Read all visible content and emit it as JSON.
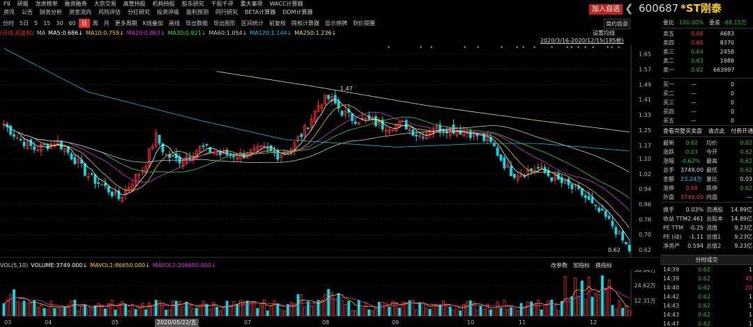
{
  "menu_row1": [
    "F9",
    "研报",
    "龙虎榜单",
    "融资融券",
    "大宗交易",
    "高管持股",
    "机构持股",
    "股东研究",
    "千股千评",
    "重大事项",
    "WACC计算器"
  ],
  "menu_row2": [
    "资讯",
    "公告",
    "财务分析",
    "资金流向",
    "风险评估",
    "分红研究",
    "投资评级",
    "盈利预测",
    "同行研究",
    "BETA计算器",
    "DDM计算器"
  ],
  "toolbar": [
    "分时",
    "5日",
    "5",
    "15",
    "30",
    "60",
    "日",
    "周",
    "月",
    "更多周期",
    "K线叠加",
    "画线",
    "导出数据",
    "导出图形",
    "区间统计",
    "前复权",
    "除权计算器",
    "显示停牌",
    "到价提醒"
  ],
  "toolbar_selected": "日",
  "jianqian": "简约版面",
  "ma_legend": [
    {
      "t": "(日线,前复权)",
      "c": "#e03030"
    },
    {
      "t": "MA",
      "c": "#cccccc"
    },
    {
      "t": "MA5:0.686↓",
      "c": "#ffffff"
    },
    {
      "t": "MA10:0.759↓",
      "c": "#ffd000"
    },
    {
      "t": "MA20:0.863↓",
      "c": "#e030e0"
    },
    {
      "t": "MA30:0.921↓",
      "c": "#30e030"
    },
    {
      "t": "MA60:1.054↓",
      "c": "#cccccc"
    },
    {
      "t": "MA120:1.144↓",
      "c": "#00c8e0"
    },
    {
      "t": "MA250:1.236↓",
      "c": "#e8e080"
    }
  ],
  "settings_btn": "设置均线",
  "range_label": "2020/3/16-2020/12/15(185根)",
  "high_label": "1.47",
  "low_label": "0.62",
  "y_ticks": [
    "1.65",
    "1.57",
    "1.49",
    "1.41",
    "1.33",
    "1.25",
    "1.17",
    "1.10",
    "1.02",
    "0.94",
    "0.86",
    "0.78",
    "0.70",
    "0.62"
  ],
  "vol_legend": [
    {
      "t": "VOL(5,10)",
      "c": "#cccccc"
    },
    {
      "t": "VOLUME:3749.000↓",
      "c": "#ffffff"
    },
    {
      "t": "MAVOL1:86650.000↓",
      "c": "#ffd000"
    },
    {
      "t": "MAVOL2:206680.000↓",
      "c": "#e030e0"
    }
  ],
  "vol_tabs": [
    "改参数",
    "加指标",
    "换指标"
  ],
  "vol_ticks": [
    "36.94万",
    "24.62万",
    "12.31万"
  ],
  "x_labels": [
    {
      "t": "03",
      "x": 6
    },
    {
      "t": "04",
      "x": 64
    },
    {
      "t": "05",
      "x": 160
    },
    {
      "t": "2020/05/22/五",
      "x": 222,
      "sel": true
    },
    {
      "t": "07",
      "x": 350
    },
    {
      "t": "08",
      "x": 462
    },
    {
      "t": "09",
      "x": 562
    },
    {
      "t": "10",
      "x": 670
    },
    {
      "t": "11",
      "x": 744
    },
    {
      "t": "12",
      "x": 846
    }
  ],
  "stock": {
    "add_btn": "加入自选",
    "code": "600687",
    "name": "*ST刚泰",
    "back_icon": "❮"
  },
  "ratio": {
    "label1": "委比",
    "val1": "-100.00%",
    "label2": "委差",
    "val2": "-68.15万"
  },
  "asks": [
    [
      "卖五",
      "0.66",
      "4683"
    ],
    [
      "卖四",
      "0.65",
      "8370"
    ],
    [
      "卖三",
      "0.64",
      "2458"
    ],
    [
      "卖二",
      "0.63",
      "1988"
    ],
    [
      "卖一",
      "0.62",
      "663997"
    ]
  ],
  "bids": [
    [
      "买一",
      "—",
      "0"
    ],
    [
      "买二",
      "—",
      "0"
    ],
    [
      "买三",
      "—",
      "0"
    ],
    [
      "买四",
      "—",
      "0"
    ],
    [
      "买五",
      "—",
      "0"
    ]
  ],
  "orderbook_btns": [
    "查看完整买卖盘",
    "请点此",
    "付费开通"
  ],
  "stats": [
    [
      "最新",
      "0.62",
      "均价",
      "0.62"
    ],
    [
      "涨跌",
      "-0.03",
      "今开",
      "0.62"
    ],
    [
      "涨幅",
      "-4.62%",
      "最高",
      "0.62"
    ],
    [
      "总手",
      "3749.00",
      "最低",
      "0.62"
    ],
    [
      "金额",
      "23.24万",
      "量比",
      "0.03"
    ],
    [
      "涨停",
      "0.68",
      "跌停",
      "0.62"
    ],
    [
      "外盘",
      "3749.00",
      "内盘",
      "—"
    ]
  ],
  "stats2": [
    [
      "换手",
      "0.03%",
      "流通股",
      "14.89亿"
    ],
    [
      "收益 TTM",
      "-2.461",
      "总股本",
      "14.89亿"
    ],
    [
      "PE TTM",
      "-0.25",
      "流值",
      "9.23亿"
    ],
    [
      "PE (动)",
      "-1.11",
      "总值1",
      "9.23亿"
    ],
    [
      "净资产",
      "0.594",
      "总值2",
      "9.23亿"
    ]
  ],
  "trade_title": "分时成交",
  "trades": [
    [
      "14:39",
      "0.62",
      "1"
    ],
    [
      "14:39",
      "0.62",
      "45"
    ],
    [
      "14:40",
      "0.62",
      "20"
    ],
    [
      "14:42",
      "0.62",
      "1"
    ],
    [
      "14:43",
      "0.62",
      "1"
    ],
    [
      "14:43",
      "0.62",
      "1"
    ],
    [
      "14:47",
      "0.62",
      "1"
    ]
  ]
}
